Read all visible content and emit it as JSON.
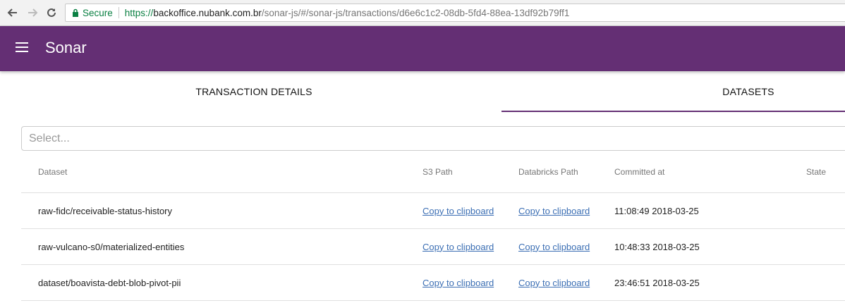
{
  "browser": {
    "secure_label": "Secure",
    "url_scheme": "https://",
    "url_host": "backoffice.nubank.com.br",
    "url_path": "/sonar-js/#/sonar-js/transactions/d6e6c1c2-08db-5fd4-88ea-13df92b79ff1"
  },
  "appbar": {
    "title": "Sonar",
    "color": "#642f74"
  },
  "tabs": [
    {
      "label": "TRANSACTION DETAILS",
      "active": false
    },
    {
      "label": "DATASETS",
      "active": true
    }
  ],
  "select": {
    "placeholder": "Select..."
  },
  "table": {
    "columns": [
      "Dataset",
      "S3 Path",
      "Databricks Path",
      "Committed at",
      "State"
    ],
    "rows": [
      {
        "dataset": "raw-fidc/receivable-status-history",
        "s3": "Copy to clipboard",
        "databricks": "Copy to clipboard",
        "committed": "11:08:49 2018-03-25",
        "state": ""
      },
      {
        "dataset": "raw-vulcano-s0/materialized-entities",
        "s3": "Copy to clipboard",
        "databricks": "Copy to clipboard",
        "committed": "10:48:33 2018-03-25",
        "state": ""
      },
      {
        "dataset": "dataset/boavista-debt-blob-pivot-pii",
        "s3": "Copy to clipboard",
        "databricks": "Copy to clipboard",
        "committed": "23:46:51 2018-03-25",
        "state": ""
      }
    ]
  },
  "icons": {
    "back": "arrow-left-icon",
    "forward": "arrow-right-icon",
    "reload": "reload-icon",
    "lock": "lock-icon",
    "menu": "hamburger-menu-icon"
  }
}
